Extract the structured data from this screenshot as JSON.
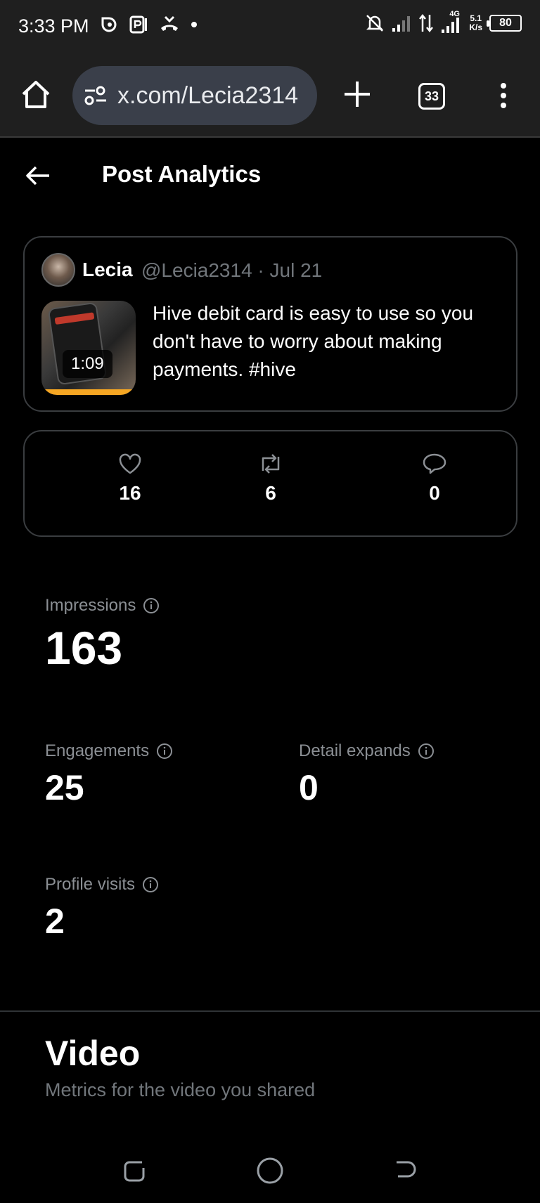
{
  "status_bar": {
    "time": "3:33 PM",
    "network_type": "4G",
    "speed_value": "5.1",
    "speed_unit": "K/s",
    "battery": "80"
  },
  "browser": {
    "url": "x.com/Lecia2314",
    "tab_count": "33"
  },
  "header": {
    "title": "Post Analytics"
  },
  "post": {
    "author_name": "Lecia",
    "author_handle": "@Lecia2314 · Jul 21",
    "video_duration": "1:09",
    "text": "Hive debit card is easy to use so you don't have to worry about making payments. #hive"
  },
  "engagement": {
    "likes": "16",
    "reposts": "6",
    "replies": "0"
  },
  "metrics": {
    "impressions_label": "Impressions",
    "impressions_value": "163",
    "engagements_label": "Engagements",
    "engagements_value": "25",
    "detail_expands_label": "Detail expands",
    "detail_expands_value": "0",
    "profile_visits_label": "Profile visits",
    "profile_visits_value": "2"
  },
  "video_section": {
    "title": "Video",
    "subtitle": "Metrics for the video you shared"
  },
  "colors": {
    "background": "#000000",
    "chrome": "#1f1f1f",
    "url_pill": "#3a3f4a",
    "muted_text": "#71767b",
    "border": "#3a3d40"
  }
}
